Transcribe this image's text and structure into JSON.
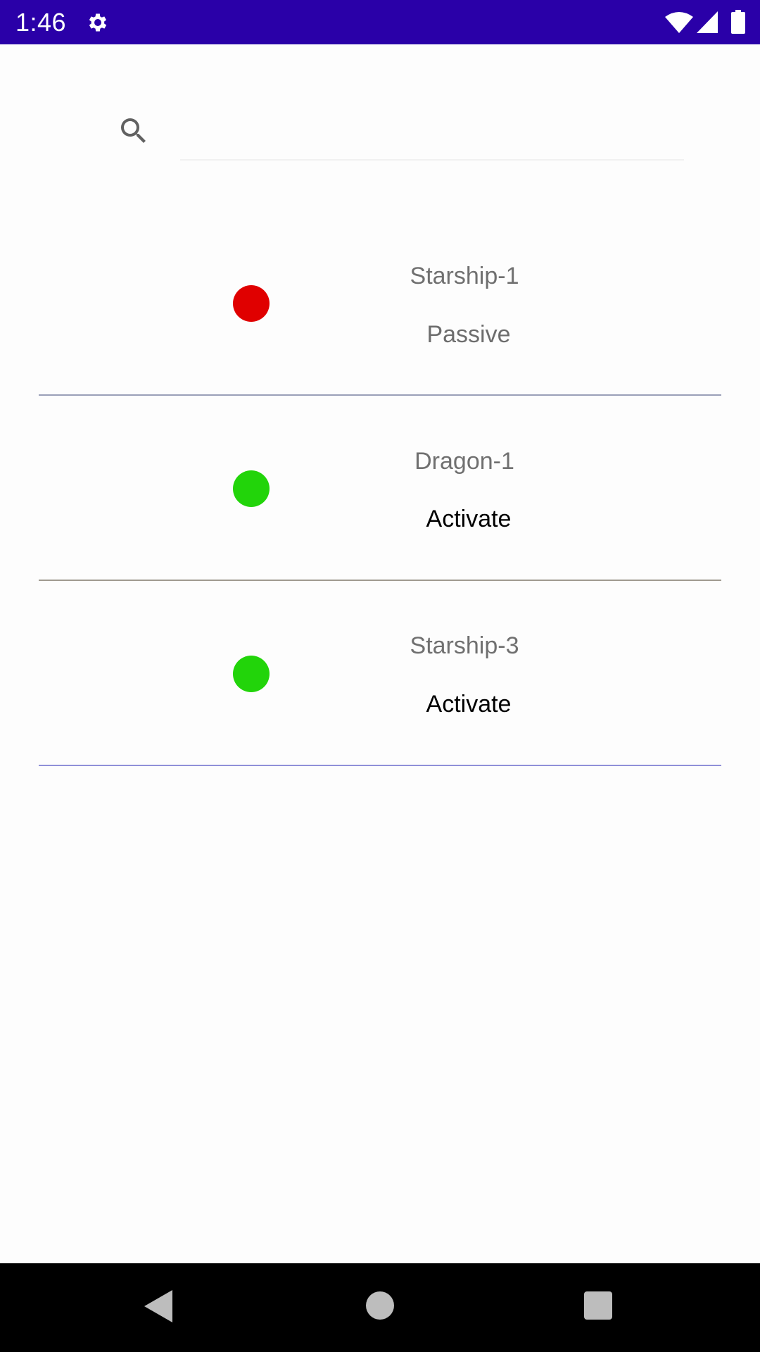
{
  "status_bar": {
    "time": "1:46",
    "icons": [
      "gear-icon",
      "wifi-icon",
      "signal-icon",
      "battery-icon"
    ],
    "background": "#2a00a8"
  },
  "search": {
    "placeholder": "",
    "value": "",
    "icon": "search-icon"
  },
  "items": [
    {
      "name": "Starship-1",
      "action": "Passive",
      "status_color": "#e00000",
      "action_color": "#6d6d6d",
      "divider_color": "#9aa0b8"
    },
    {
      "name": "Dragon-1",
      "action": "Activate",
      "status_color": "#22d40a",
      "action_color": "#000000",
      "divider_color": "#a09a90"
    },
    {
      "name": "Starship-3",
      "action": "Activate",
      "status_color": "#22d40a",
      "action_color": "#000000",
      "divider_color": "#8f90d8"
    }
  ],
  "nav_bar": {
    "icons": [
      "back-icon",
      "home-icon",
      "recents-icon"
    ]
  }
}
